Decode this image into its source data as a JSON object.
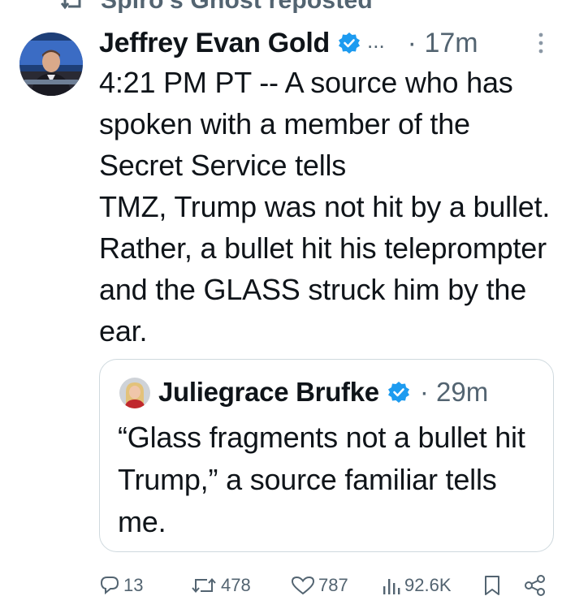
{
  "repost": {
    "text": "Spiro's Ghost reposted"
  },
  "tweet": {
    "author": "Jeffrey Evan Gold",
    "ellipsis": "...",
    "time": "· 17m",
    "text": "4:21 PM PT -- A source who has spoken with a member of the Secret Service tells\nTMZ, Trump was not hit by a bullet. Rather, a bullet hit his teleprompter and the GLASS struck him by the ear."
  },
  "quote": {
    "author": "Juliegrace Brufke",
    "time": "· 29m",
    "text": "“Glass fragments not a bullet hit Trump,” a source familiar tells me."
  },
  "actions": {
    "replies": "13",
    "reposts": "478",
    "likes": "787",
    "views": "92.6K"
  },
  "colors": {
    "verified": "#1d9bf0",
    "muted": "#536471",
    "border": "#cfd9de",
    "text": "#0f1419"
  },
  "icons": [
    "repost-icon",
    "verified-icon",
    "more-icon",
    "reply-icon",
    "retweet-icon",
    "like-icon",
    "views-icon",
    "bookmark-icon",
    "share-icon"
  ]
}
